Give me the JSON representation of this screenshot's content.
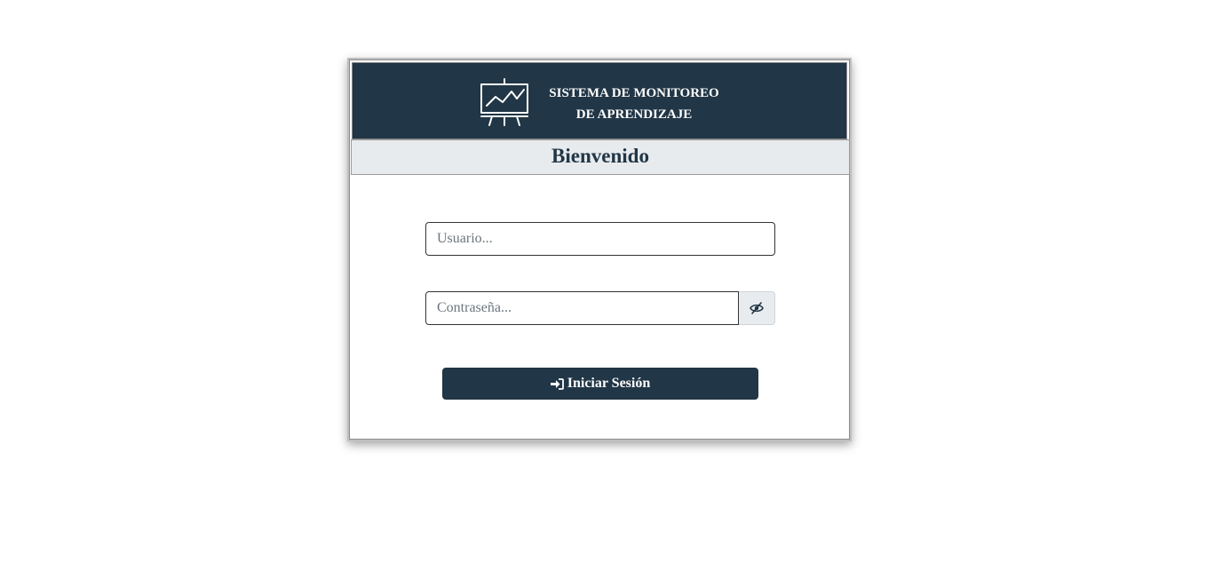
{
  "header": {
    "title_line1": "SISTEMA DE MONITOREO",
    "title_line2": "DE APRENDIZAJE",
    "logo_icon": "presentation-chart-icon",
    "background_color": "#213646"
  },
  "welcome": {
    "text": "Bienvenido"
  },
  "form": {
    "username": {
      "placeholder": "Usuario...",
      "value": ""
    },
    "password": {
      "placeholder": "Contraseña...",
      "value": "",
      "toggle_icon": "eye-slash-icon"
    },
    "submit": {
      "label": "Iniciar Sesión",
      "icon": "sign-in-icon"
    }
  }
}
